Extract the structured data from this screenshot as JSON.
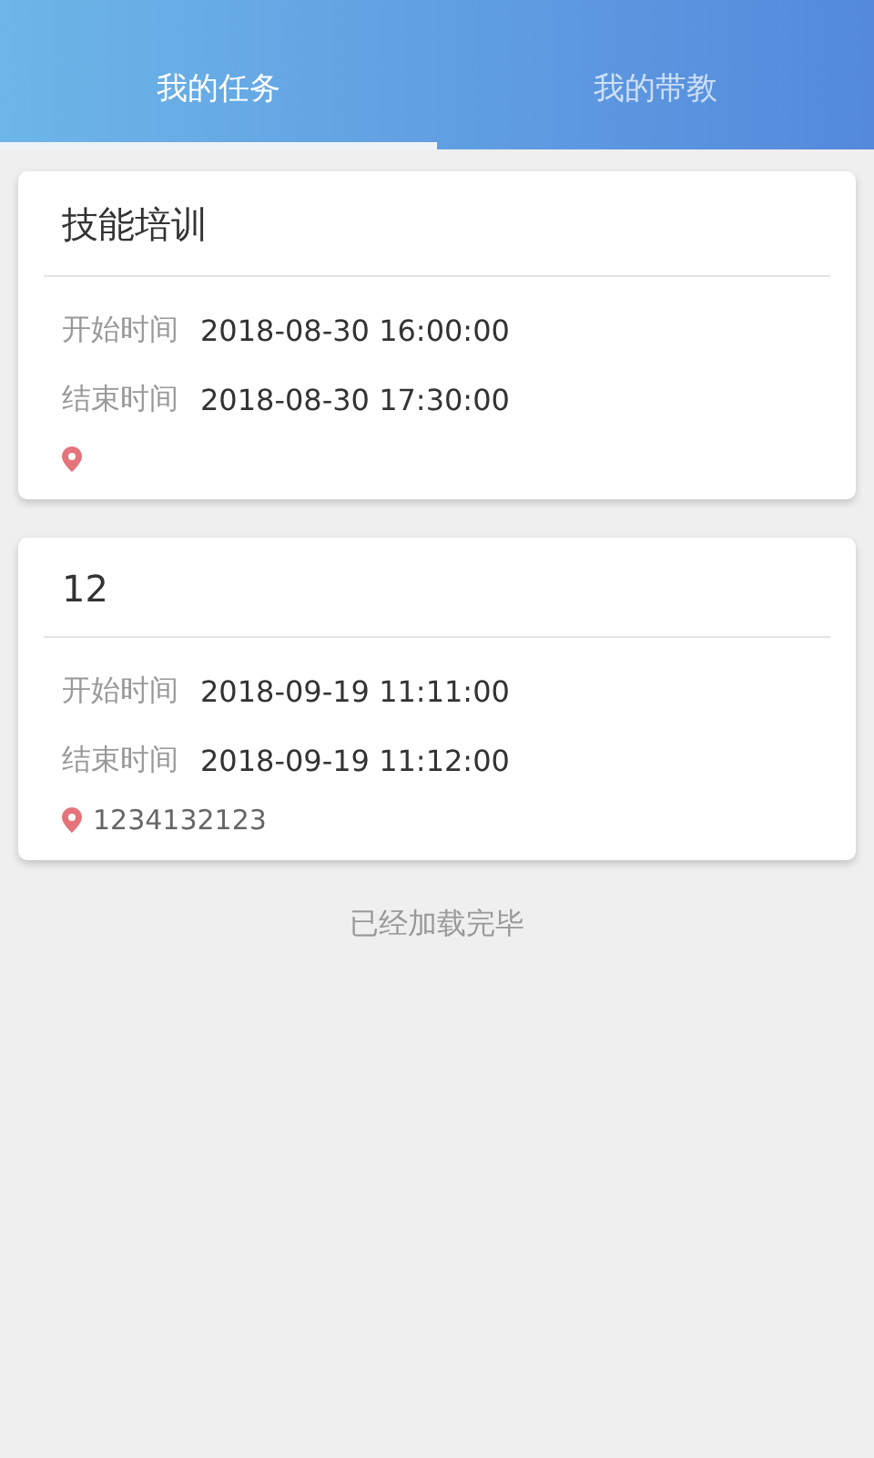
{
  "tabs": [
    {
      "label": "我的任务",
      "selected": true
    },
    {
      "label": "我的带教",
      "selected": false
    }
  ],
  "tasks": [
    {
      "title": "技能培训",
      "fields": [
        {
          "label": "开始时间",
          "value": "2018-08-30 16:00:00"
        },
        {
          "label": "结束时间",
          "value": "2018-08-30 17:30:00"
        }
      ]
    },
    {
      "title": "12",
      "fields": [
        {
          "label": "开始时间",
          "value": "2018-09-19 11:11:00"
        },
        {
          "label": "结束时间",
          "value": "2018-09-19 11:12:00"
        }
      ],
      "location": "1234132123"
    }
  ],
  "footer": "已经加载完毕"
}
